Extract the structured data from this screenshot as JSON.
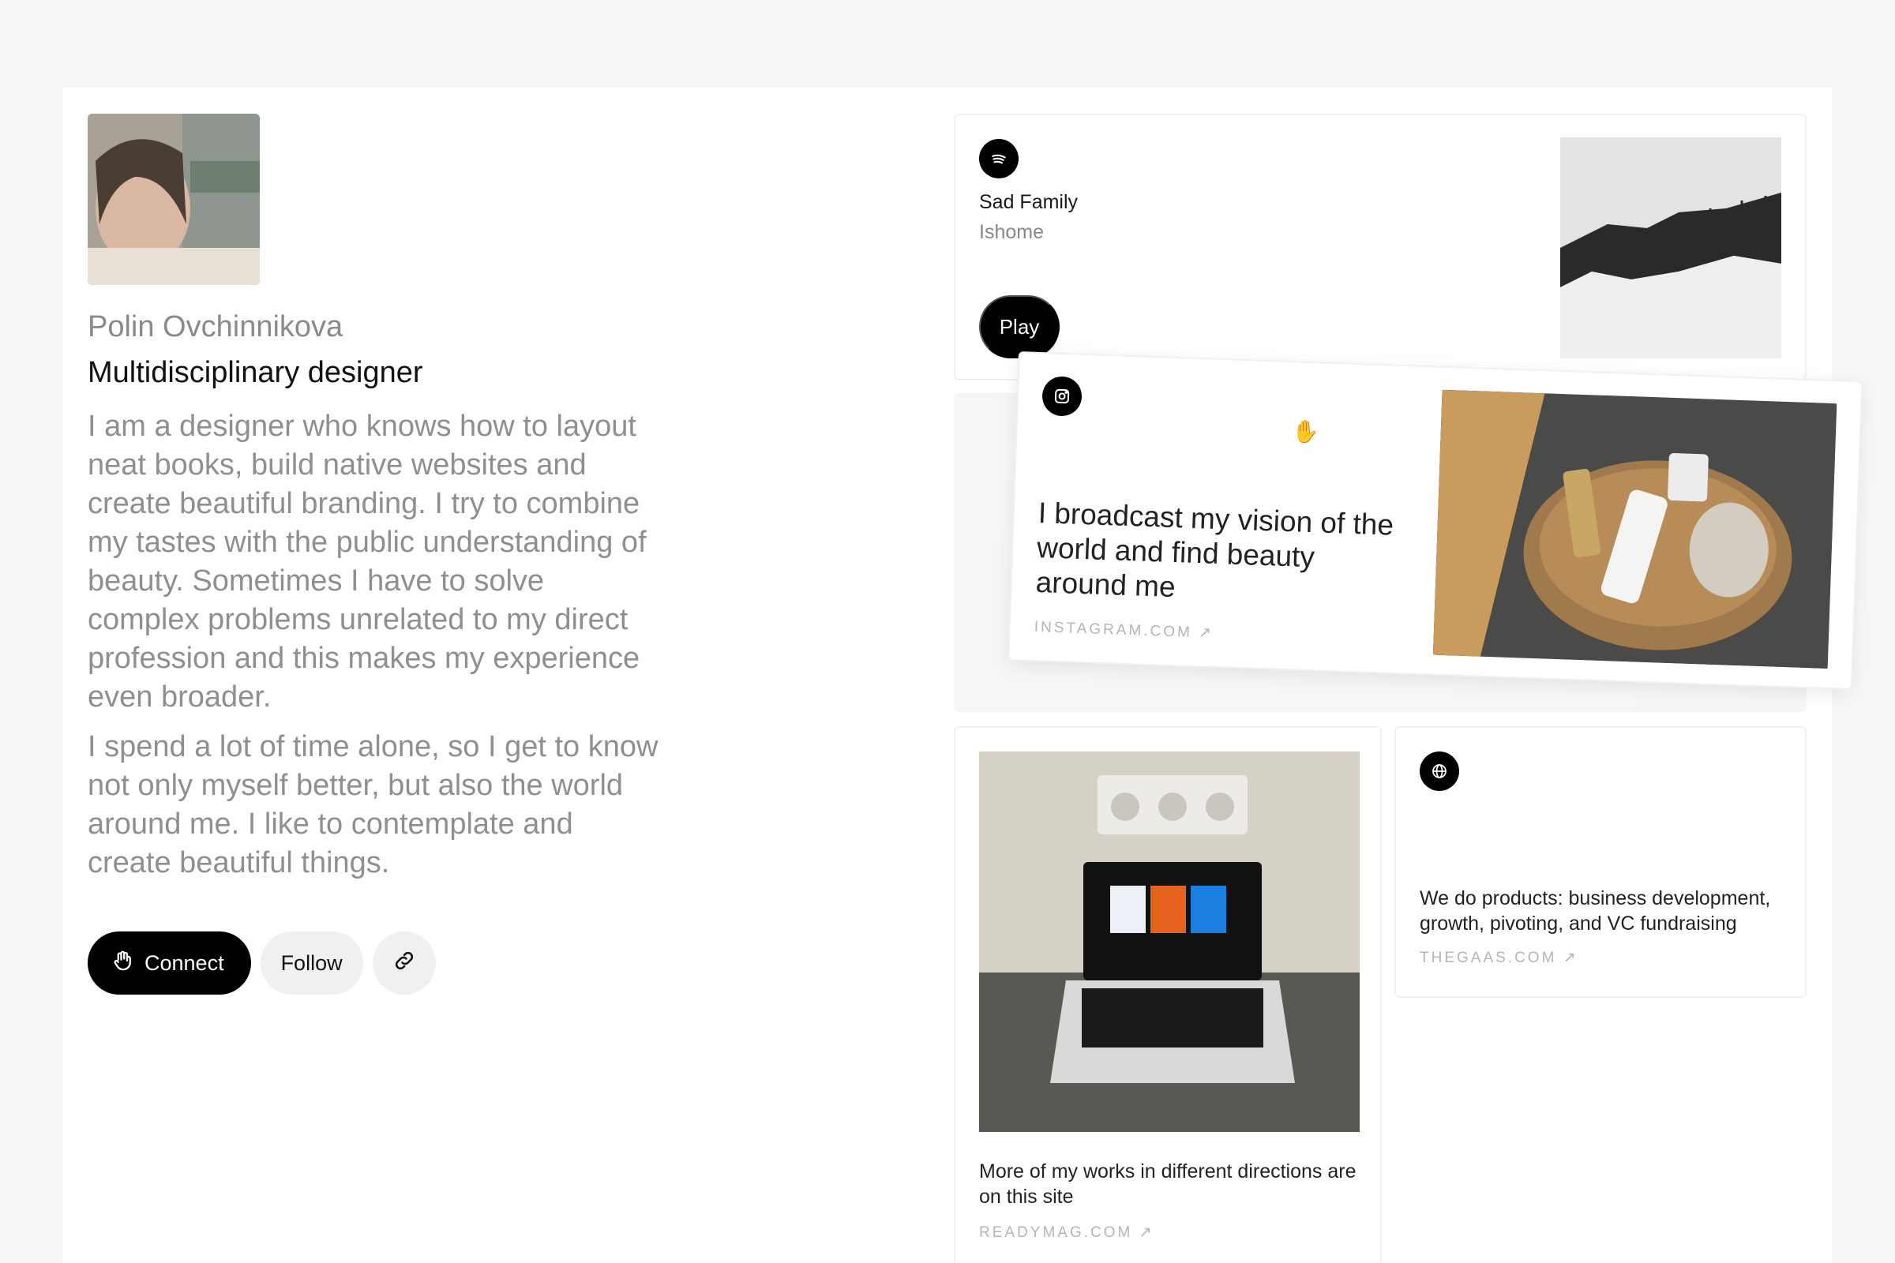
{
  "profile": {
    "name": "Polin Ovchinnikova",
    "role": "Multidisciplinary designer",
    "bio": [
      "I am a designer who knows how to layout neat books, build native websites and create beautiful branding. I try to combine my tastes with the public understanding of beauty. Sometimes I have to solve complex problems unrelated to my direct profession and this makes my experience even broader.",
      "I spend a lot of time alone, so I get to know not only myself better, but also the world around me. I like to contemplate and create beautiful things."
    ]
  },
  "actions": {
    "connect_label": "Connect",
    "follow_label": "Follow"
  },
  "spotify": {
    "song": "Sad Family",
    "artist": "Ishome",
    "play_label": "Play",
    "icon": "spotify-icon"
  },
  "instagram": {
    "text": "I broadcast my vision of the world and find beauty around me",
    "domain": "INSTAGRAM.COM ↗",
    "icon": "instagram-icon"
  },
  "readymag": {
    "text": "More of my works in different directions are on this site",
    "domain": "READYMAG.COM ↗"
  },
  "thegaas": {
    "text": "We do products: business development, growth, pivoting, and VC fundraising",
    "domain": "THEGAAS.COM ↗",
    "icon": "globe-icon"
  }
}
